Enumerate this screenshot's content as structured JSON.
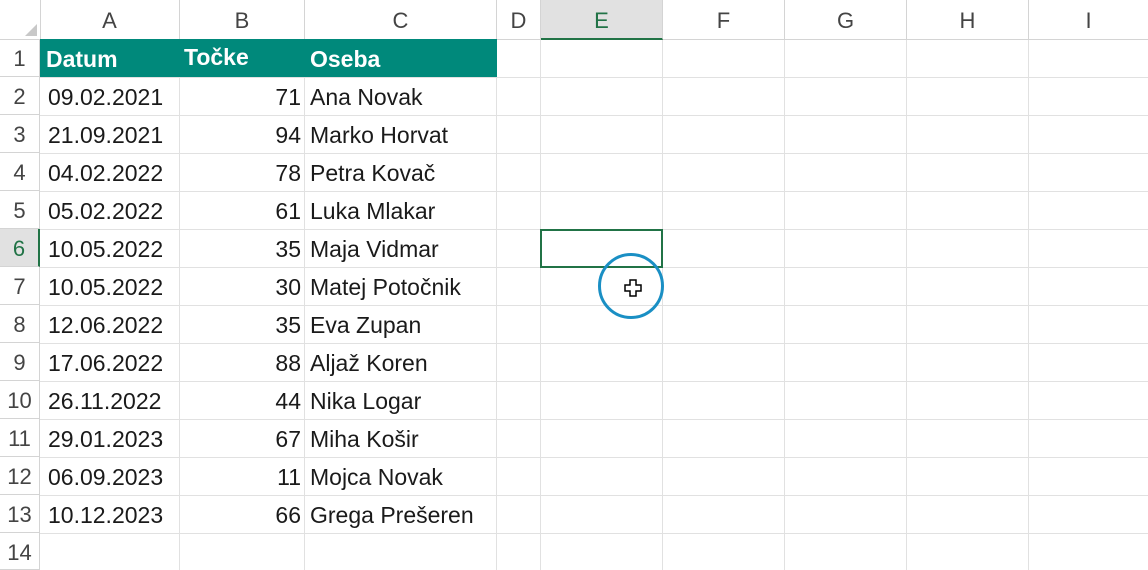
{
  "columns": [
    "A",
    "B",
    "C",
    "D",
    "E",
    "F",
    "G",
    "H",
    "I"
  ],
  "rows": [
    "1",
    "2",
    "3",
    "4",
    "5",
    "6",
    "7",
    "8",
    "9",
    "10",
    "11",
    "12",
    "13",
    "14"
  ],
  "active_cell": "E6",
  "table": {
    "headers": {
      "datum": "Datum",
      "tocke": "Točke",
      "oseba": "Oseba"
    },
    "header_color": "#00897b",
    "records": [
      {
        "datum": "09.02.2021",
        "tocke": "71",
        "oseba": "Ana Novak"
      },
      {
        "datum": "21.09.2021",
        "tocke": "94",
        "oseba": "Marko Horvat"
      },
      {
        "datum": "04.02.2022",
        "tocke": "78",
        "oseba": "Petra Kovač"
      },
      {
        "datum": "05.02.2022",
        "tocke": "61",
        "oseba": "Luka Mlakar"
      },
      {
        "datum": "10.05.2022",
        "tocke": "35",
        "oseba": "Maja Vidmar"
      },
      {
        "datum": "10.05.2022",
        "tocke": "30",
        "oseba": "Matej Potočnik"
      },
      {
        "datum": "12.06.2022",
        "tocke": "35",
        "oseba": "Eva Zupan"
      },
      {
        "datum": "17.06.2022",
        "tocke": "88",
        "oseba": "Aljaž Koren"
      },
      {
        "datum": "26.11.2022",
        "tocke": "44",
        "oseba": "Nika Logar"
      },
      {
        "datum": "29.01.2023",
        "tocke": "67",
        "oseba": "Miha Košir"
      },
      {
        "datum": "06.09.2023",
        "tocke": "11",
        "oseba": "Mojca Novak"
      },
      {
        "datum": "10.12.2023",
        "tocke": "66",
        "oseba": "Grega Prešeren"
      }
    ]
  },
  "icons": {
    "cursor": "cell-select-cross-icon",
    "click_indicator": "click-ring-icon"
  },
  "colors": {
    "selection": "#217346",
    "click_ring": "#1a8fc4"
  }
}
